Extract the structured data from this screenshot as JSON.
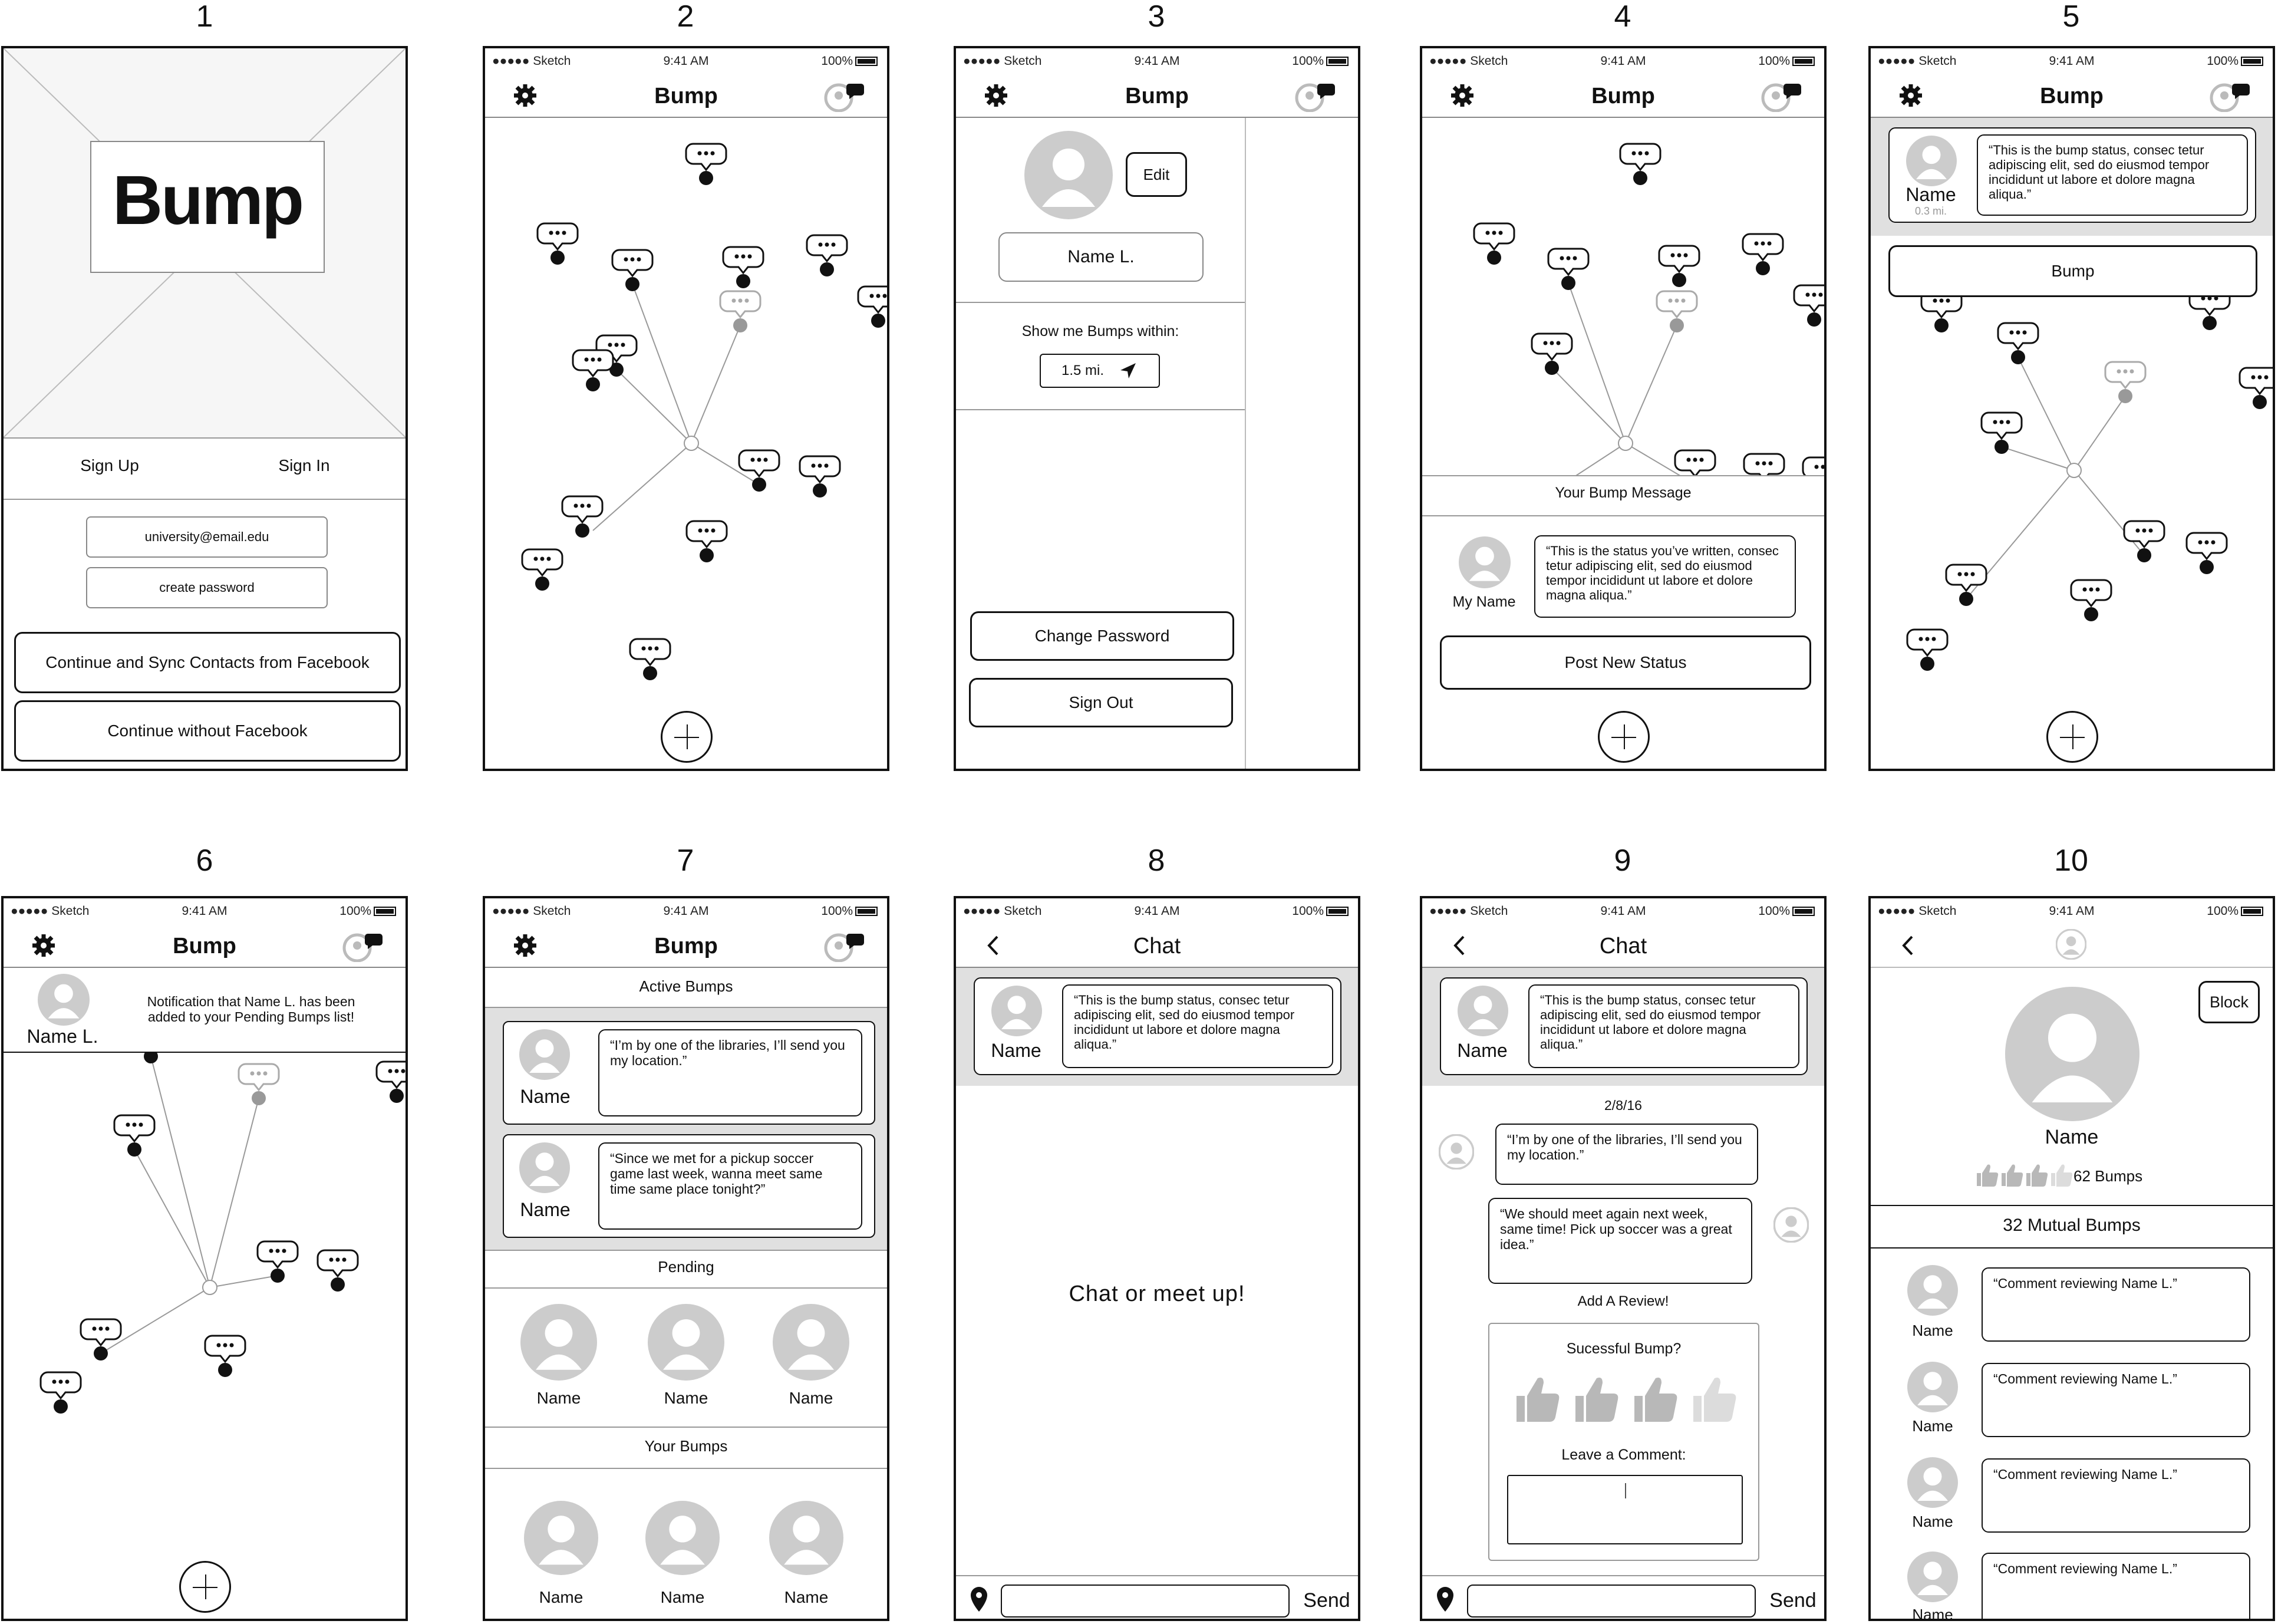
{
  "screen_numbers": [
    "1",
    "2",
    "3",
    "4",
    "5",
    "6",
    "7",
    "8",
    "9",
    "10"
  ],
  "status_bar": {
    "carrier": "●●●●● Sketch",
    "time": "9:41 AM",
    "battery": "100%"
  },
  "app_title": "Bump",
  "chat_title": "Chat",
  "s1": {
    "logo": "Bump",
    "signup": "Sign Up",
    "signin": "Sign In",
    "email": "university@email.edu",
    "password": "create password",
    "fb_button": "Continue and Sync Contacts from Facebook",
    "no_fb_button": "Continue without Facebook"
  },
  "s3": {
    "edit": "Edit",
    "name": "Name L.",
    "show_within": "Show me Bumps within:",
    "distance": "1.5 mi.",
    "change_password": "Change Password",
    "sign_out": "Sign Out"
  },
  "s4": {
    "your_message": "Your Bump Message",
    "my_name": "My Name",
    "status": "“This is the status you’ve written, consec tetur adipiscing elit, sed do eiusmod tempor incididunt ut labore et dolore magna aliqua.”",
    "post": "Post New Status"
  },
  "s5": {
    "name": "Name",
    "dist": "0.3 mi.",
    "status": "“This is the bump status, consec tetur adipiscing elit, sed do eiusmod tempor incididunt ut labore et dolore magna aliqua.”",
    "bump": "Bump"
  },
  "s6": {
    "name": "Name L.",
    "notification": "Notification that Name L. has been added to your Pending Bumps list!"
  },
  "s7": {
    "active": "Active Bumps",
    "msg1_name": "Name",
    "msg1": "“I’m by one of the libraries, I’ll send you my location.”",
    "msg2_name": "Name",
    "msg2": "“Since we met for a pickup soccer game last week, wanna meet same time same place tonight?”",
    "pending": "Pending",
    "pending_names": [
      "Name",
      "Name",
      "Name"
    ],
    "your_bumps": "Your Bumps",
    "your_names": [
      "Name",
      "Name",
      "Name"
    ]
  },
  "s8": {
    "name": "Name",
    "status": "“This is the bump status, consec tetur adipiscing elit, sed do eiusmod tempor incididunt ut labore et dolore magna aliqua.”",
    "center": "Chat or meet up!",
    "send": "Send"
  },
  "s9": {
    "name": "Name",
    "status": "“This is the bump status, consec tetur adipiscing elit, sed do eiusmod tempor incididunt ut labore et dolore magna aliqua.”",
    "date": "2/8/16",
    "msg_in": "“I’m by one of the libraries, I’ll send you my location.”",
    "msg_out": "“We should meet again next week, same time! Pick up soccer was a great idea.”",
    "add_review": "Add A Review!",
    "successful": "Sucessful Bump?",
    "leave_comment": "Leave a Comment:",
    "send": "Send"
  },
  "s10": {
    "block": "Block",
    "name": "Name",
    "bump_count": "62 Bumps",
    "mutual": "32 Mutual Bumps",
    "reviews": [
      {
        "name": "Name",
        "text": "“Comment reviewing Name L.”"
      },
      {
        "name": "Name",
        "text": "“Comment reviewing Name L.”"
      },
      {
        "name": "Name",
        "text": "“Comment reviewing Name L.”"
      },
      {
        "name": "Name",
        "text": "“Comment reviewing Name L.”"
      }
    ]
  }
}
